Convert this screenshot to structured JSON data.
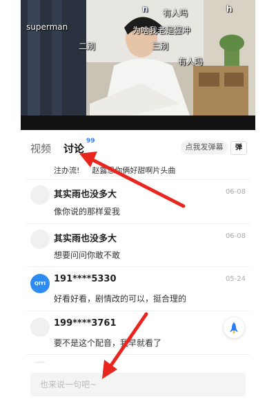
{
  "video": {
    "danmaku": [
      "superman",
      "有人吗",
      "为啥我老是猩冲",
      "二刷",
      "三刷",
      "有人吗",
      "n",
      "h"
    ]
  },
  "tabs": {
    "video_label": "视频",
    "discussion_label": "讨论",
    "discussion_badge": "99"
  },
  "danmu": {
    "send_label": "点我发弹幕",
    "toggle_label": "弹"
  },
  "comments": {
    "partial_text": "注办流! 　 赵露思你俩好甜啊片头曲",
    "items": [
      {
        "username": "其实雨也没多大",
        "date": "06-08",
        "text": "像你说的那样爱我"
      },
      {
        "username": "其实雨也没多大",
        "date": "06-08",
        "text": "想要问问你敢不敢"
      },
      {
        "username": "191****5330",
        "date": "05-24",
        "text": "好看好看，剧情改的可以，挺合理的",
        "avatar_text": "QIYI"
      },
      {
        "username": "199****3761",
        "date": "",
        "text": "要不是这个配音，我早就看了"
      }
    ]
  },
  "input": {
    "placeholder": "也来说一句吧~"
  },
  "colors": {
    "accent": "#2d7cff",
    "arrow": "#e8261f"
  }
}
